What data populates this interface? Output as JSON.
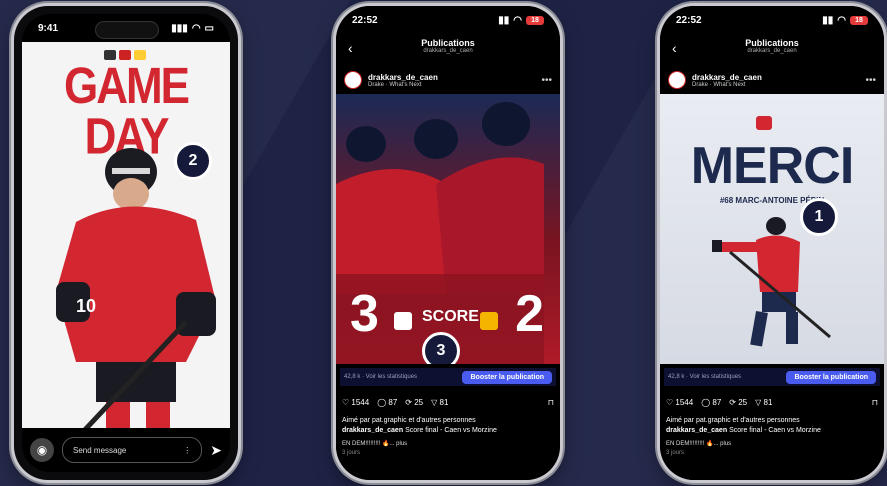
{
  "phone_left": {
    "time": "9:41",
    "story": {
      "header_left": "",
      "header_right": "",
      "headline": "GAME DAY",
      "jersey_number": "10",
      "message_placeholder": "Send message"
    }
  },
  "phone_middle": {
    "time": "22:52",
    "battery": "18",
    "nav_title": "Publications",
    "nav_subtitle": "drakkars_de_caen",
    "account": "drakkars_de_caen",
    "song": "Drake · What's Next",
    "score_home": "3",
    "score_label": "SCORE",
    "score_away": "2",
    "stats_link": "42,8 k · Voir les statistiques",
    "boost": "Booster la publication",
    "counts": {
      "likes": "1544",
      "comments": "87",
      "reposts": "25",
      "shares": "81"
    },
    "liked_by": "Aimé par pat.graphic et d'autres personnes",
    "caption_user": "drakkars_de_caen",
    "caption": "Score final - Caen vs Morzine",
    "caption_more": "EN DEM!!!!!!!!! 🔥... plus",
    "time_ago": "3 jours"
  },
  "phone_right": {
    "time": "22:52",
    "battery": "18",
    "nav_title": "Publications",
    "nav_subtitle": "drakkars_de_caen",
    "account": "drakkars_de_caen",
    "song": "Drake · What's Next",
    "headline": "MERCI",
    "subline": "#68 MARC-ANTOINE PÉPIN",
    "stats_link": "42,8 k · Voir les statistiques",
    "boost": "Booster la publication",
    "counts": {
      "likes": "1544",
      "comments": "87",
      "reposts": "25",
      "shares": "81"
    },
    "liked_by": "Aimé par pat.graphic et d'autres personnes",
    "caption_user": "drakkars_de_caen",
    "caption": "Score final - Caen vs Morzine",
    "caption_more": "EN DEM!!!!!!!!! 🔥... plus",
    "time_ago": "3 jours"
  },
  "callouts": {
    "one": "1",
    "two": "2",
    "three": "3"
  },
  "colors": {
    "brand_red": "#d22630",
    "navy": "#1e2346",
    "boost_blue": "#4a5cf0"
  }
}
